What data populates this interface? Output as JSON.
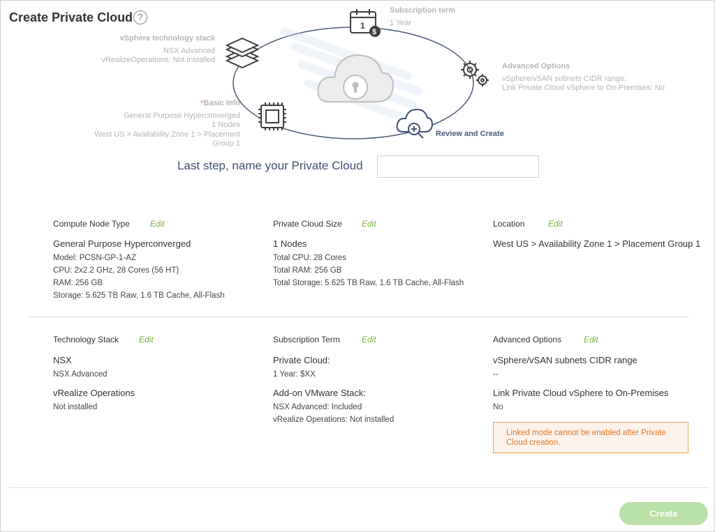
{
  "header": {
    "title": "Create Private Cloud",
    "help_glyph": "?"
  },
  "wizard": {
    "subscription": {
      "title": "Subscription term",
      "line1": "1 Year",
      "icon": "calendar-dollar-icon",
      "cal_day": "1",
      "dollar": "$"
    },
    "tech_stack": {
      "title": "vSphere technology stack",
      "line1": "NSX Advanced",
      "line2": "vRealizeOperations: Not installed",
      "icon": "layers-icon"
    },
    "advanced": {
      "title": "Advanced Options",
      "line1": "vSphere/vSAN subnets CIDR range:",
      "line2": "Link Private Cloud vSphere to On-Premises: No",
      "icon": "gears-icon"
    },
    "basic": {
      "required_mark": "*",
      "title": "Basic Info",
      "line1": "General Purpose Hyperconverged",
      "line2": "1 Nodes",
      "line3": "West US > Availability Zone 1 > Placement",
      "line4": "Group 1",
      "icon": "chip-icon"
    },
    "review": {
      "title": "Review and Create",
      "icon": "cloud-search-icon"
    },
    "center_icon": "cloud-lock-icon"
  },
  "name_step": {
    "label": "Last step, name your Private Cloud",
    "value": "",
    "placeholder": ""
  },
  "summary": {
    "edit_label": "Edit",
    "compute": {
      "heading": "Compute Node Type",
      "name": "General Purpose Hyperconverged",
      "model": "Model: PCSN-GP-1-AZ",
      "cpu": "CPU: 2x2.2 GHz, 28 Cores (56 HT)",
      "ram": "RAM: 256 GB",
      "storage": "Storage: 5.625 TB Raw, 1.6 TB Cache, All-Flash"
    },
    "size": {
      "heading": "Private Cloud Size",
      "nodes": "1 Nodes",
      "cpu": "Total CPU: 28 Cores",
      "ram": "Total RAM: 256 GB",
      "storage": "Total Storage: 5.625 TB Raw, 1.6 TB Cache, All-Flash"
    },
    "location": {
      "heading": "Location",
      "value": "West US > Availability Zone 1 > Placement Group 1"
    },
    "tech": {
      "heading": "Technology Stack",
      "nsx_title": "NSX",
      "nsx_value": "NSX Advanced",
      "vrops_title": "vRealize Operations",
      "vrops_value": "Not installed"
    },
    "term": {
      "heading": "Subscription Term",
      "pc_title": "Private Cloud:",
      "pc_value": "1 Year: $XX",
      "addon_title": "Add-on VMware Stack:",
      "addon_nsx": "NSX Advanced: Included",
      "addon_vrops": "vRealize Operations: Not installed"
    },
    "advanced": {
      "heading": "Advanced Options",
      "cidr_title": "vSphere/vSAN subnets CIDR range",
      "cidr_value": "--",
      "link_title": "Link Private Cloud vSphere to On-Premises",
      "link_value": "No",
      "warning": "Linked mode cannot be enabled after Private Cloud creation."
    }
  },
  "footer": {
    "create_label": "Create"
  },
  "colors": {
    "accent_green": "#7bb13a",
    "button_disabled": "#b9e0a6",
    "heading_blue": "#3f5070",
    "warning_orange": "#e0762a"
  }
}
